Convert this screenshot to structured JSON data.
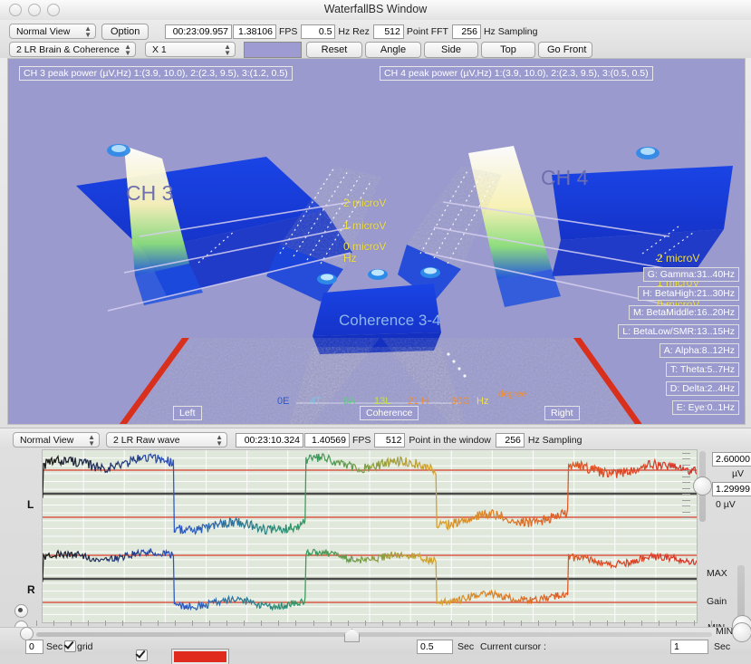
{
  "window": {
    "title": "WaterfallBS Window",
    "controls": [
      "close",
      "minimize",
      "zoom"
    ]
  },
  "toolbar_top": {
    "view_mode": "Normal View",
    "option_label": "Option",
    "time": "00:23:09.957",
    "fps_value": "1.38106",
    "fps_label": "FPS",
    "hz_rez_value": "0.5",
    "hz_rez_label": "Hz Rez",
    "point_fft_value": "512",
    "point_fft_label": "Point FFT",
    "sampling_value": "256",
    "sampling_label": "Hz Sampling",
    "display_mode": "2 LR Brain & Coherence",
    "zoom_factor": "X 1",
    "color_swatch": "#9d9bd2",
    "buttons": [
      "Reset",
      "Angle",
      "Side",
      "Top",
      "Go Front"
    ]
  },
  "view3d": {
    "ch3_header": "CH 3 peak power (µV,Hz) 1:(3.9, 10.0), 2:(2.3, 9.5), 3:(1.2, 0.5)",
    "ch4_header": "CH 4 peak power (µV,Hz) 1:(3.9, 10.0), 2:(2.3, 9.5), 3:(0.5, 0.5)",
    "ch3_label": "CH 3",
    "ch4_label": "CH 4",
    "coherence_label": "Coherence 3-4",
    "ch3_axis": [
      "2 microV",
      "1 microV",
      "0 microV",
      "Hz"
    ],
    "ch4_axis": [
      "2 microV",
      "1 microV",
      "0 microV",
      "Hz"
    ],
    "coherence_axis": [
      "0E",
      "4T",
      "8A",
      "13L",
      "21 H",
      "30G",
      "Hz",
      "degree"
    ],
    "view_buttons": [
      "Left",
      "Coherence",
      "Right"
    ],
    "legend": [
      "G: Gamma:31..40Hz",
      "H: BetaHigh:21..30Hz",
      "M: BetaMiddle:16..20Hz",
      "L: BetaLow/SMR:13..15Hz",
      "A: Alpha:8..12Hz",
      "T: Theta:5..7Hz",
      "D: Delta:2..4Hz",
      "E: Eye:0..1Hz"
    ],
    "background_color": "#9a9ace"
  },
  "toolbar_wave": {
    "view_mode": "Normal View",
    "display_mode": "2 LR Raw wave",
    "time": "00:23:10.324",
    "fps_value": "1.40569",
    "fps_label": "FPS",
    "points_value": "512",
    "points_label": "Point in the window",
    "sampling_value": "256",
    "sampling_label": "Hz Sampling"
  },
  "wave_panel": {
    "channel_labels": [
      "L",
      "R"
    ],
    "scale_max": "2.60000",
    "scale_max_unit": "µV",
    "scale_mid": "1.29999",
    "scale_zero": "0 µV",
    "gain_label": "Gain",
    "gain_max": "MAX",
    "gain_min": "MIN",
    "background_color": "#dfe8da"
  },
  "footer": {
    "start_sec_value": "0",
    "start_sec_label": "Sec",
    "grid_label": "grid",
    "grid_checked": true,
    "window_sec_value": "0.5",
    "window_sec_label": "Sec",
    "current_cursor_label": "Current cursor :",
    "cursor_value": "1",
    "cursor_unit": "Sec",
    "min_label": "MIN"
  },
  "chart_data": {
    "type": "line",
    "title": "2 LR Raw wave",
    "xlabel": "Sec",
    "ylabel": "µV",
    "ylim": [
      0,
      2.6
    ],
    "grid": true,
    "series": [
      {
        "name": "L",
        "color_sweep": [
          "#1b1b1b",
          "#2b54c8",
          "#2f9a5e",
          "#d8a12a",
          "#e05a22",
          "#d8342a"
        ]
      },
      {
        "name": "R",
        "color_sweep": [
          "#1b1b1b",
          "#2b54c8",
          "#2f9a5e",
          "#d8a12a",
          "#e05a22",
          "#d8342a"
        ]
      }
    ]
  }
}
